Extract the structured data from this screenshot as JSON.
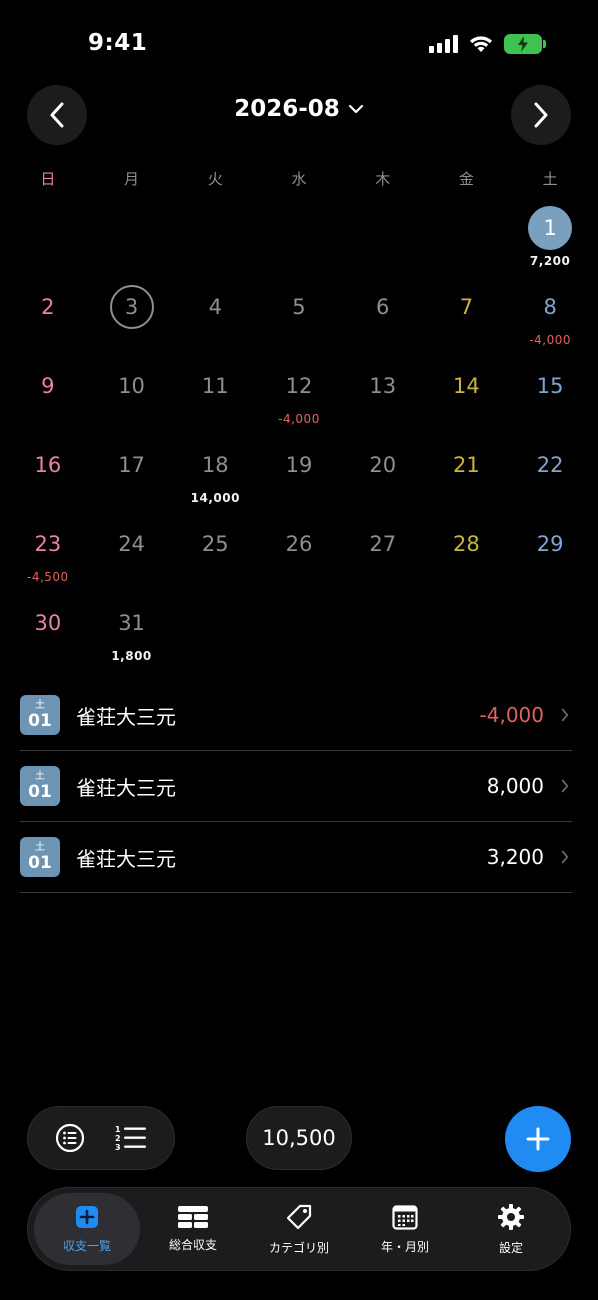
{
  "status_bar": {
    "time": "9:41"
  },
  "header": {
    "month": "2026-08"
  },
  "weekdays": [
    "日",
    "月",
    "火",
    "水",
    "木",
    "金",
    "土"
  ],
  "calendar": {
    "days": [
      {
        "d": "1",
        "amount": "7,200",
        "neg": false,
        "col": 7,
        "selected": true
      },
      {
        "d": "2",
        "amount": "",
        "neg": false,
        "col": 1
      },
      {
        "d": "3",
        "amount": "",
        "neg": false,
        "col": 2,
        "today": true
      },
      {
        "d": "4",
        "amount": "",
        "col": 3
      },
      {
        "d": "5",
        "amount": "",
        "col": 4
      },
      {
        "d": "6",
        "amount": "",
        "col": 5
      },
      {
        "d": "7",
        "amount": "",
        "col": 6
      },
      {
        "d": "8",
        "amount": "-4,000",
        "neg": true,
        "col": 7
      },
      {
        "d": "9",
        "amount": "",
        "col": 1
      },
      {
        "d": "10",
        "amount": "",
        "col": 2
      },
      {
        "d": "11",
        "amount": "",
        "col": 3
      },
      {
        "d": "12",
        "amount": "-4,000",
        "neg": true,
        "col": 4
      },
      {
        "d": "13",
        "amount": "",
        "col": 5
      },
      {
        "d": "14",
        "amount": "",
        "col": 6
      },
      {
        "d": "15",
        "amount": "",
        "col": 7
      },
      {
        "d": "16",
        "amount": "",
        "col": 1
      },
      {
        "d": "17",
        "amount": "",
        "col": 2
      },
      {
        "d": "18",
        "amount": "14,000",
        "neg": false,
        "col": 3
      },
      {
        "d": "19",
        "amount": "",
        "col": 4
      },
      {
        "d": "20",
        "amount": "",
        "col": 5
      },
      {
        "d": "21",
        "amount": "",
        "col": 6
      },
      {
        "d": "22",
        "amount": "",
        "col": 7
      },
      {
        "d": "23",
        "amount": "-4,500",
        "neg": true,
        "col": 1
      },
      {
        "d": "24",
        "amount": "",
        "col": 2
      },
      {
        "d": "25",
        "amount": "",
        "col": 3
      },
      {
        "d": "26",
        "amount": "",
        "col": 4
      },
      {
        "d": "27",
        "amount": "",
        "col": 5
      },
      {
        "d": "28",
        "amount": "",
        "col": 6
      },
      {
        "d": "29",
        "amount": "",
        "col": 7
      },
      {
        "d": "30",
        "amount": "",
        "col": 1
      },
      {
        "d": "31",
        "amount": "1,800",
        "neg": false,
        "col": 2
      }
    ]
  },
  "transactions": [
    {
      "weekday": "土",
      "day": "01",
      "name": "雀荘大三元",
      "amount": "-4,000",
      "neg": true
    },
    {
      "weekday": "土",
      "day": "01",
      "name": "雀荘大三元",
      "amount": "8,000",
      "neg": false
    },
    {
      "weekday": "土",
      "day": "01",
      "name": "雀荘大三元",
      "amount": "3,200",
      "neg": false
    }
  ],
  "bottom": {
    "total": "10,500"
  },
  "tabs": [
    {
      "label": "収支一覧",
      "icon": "plus-square-icon",
      "active": true
    },
    {
      "label": "総合収支",
      "icon": "grid-icon",
      "active": false
    },
    {
      "label": "カテゴリ別",
      "icon": "tag-icon",
      "active": false
    },
    {
      "label": "年・月別",
      "icon": "calendar-icon",
      "active": false
    },
    {
      "label": "設定",
      "icon": "gear-icon",
      "active": false
    }
  ],
  "colors": {
    "accent": "#1f8bf3",
    "sunday": "#e8849c",
    "saturday": "#7fa6cf",
    "friday": "#c9b637",
    "negative": "#e0625f",
    "selected": "#7ba0bd"
  }
}
